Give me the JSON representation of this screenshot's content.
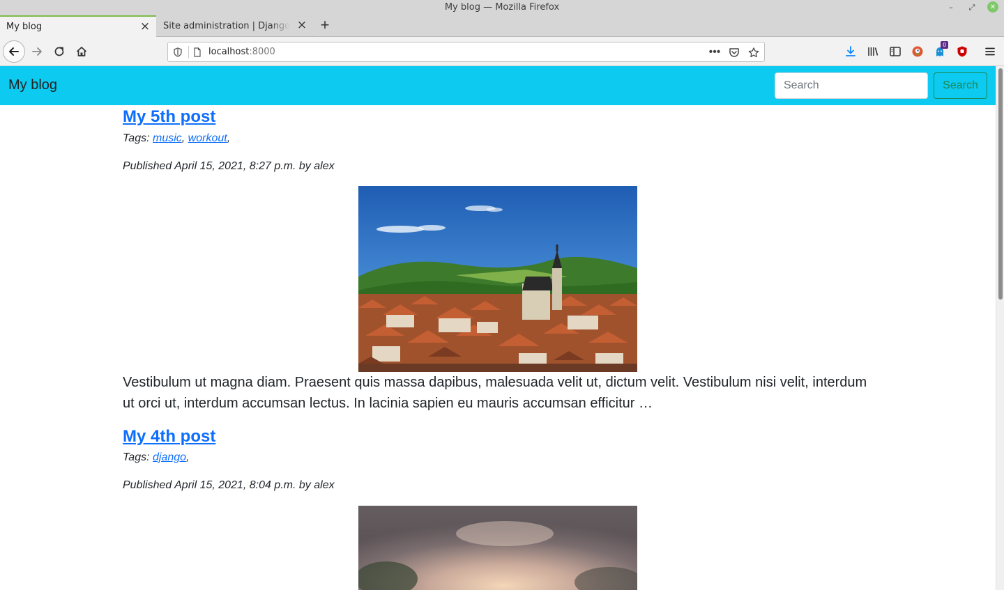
{
  "window": {
    "title": "My blog — Mozilla Firefox"
  },
  "tabs": [
    {
      "label": "My blog",
      "active": true
    },
    {
      "label": "Site administration | Django site admin",
      "active": false
    }
  ],
  "urlbar": {
    "host": "localhost",
    "port": ":8000"
  },
  "toolbar": {
    "notification_badge": "0"
  },
  "site": {
    "brand": "My blog",
    "search_placeholder": "Search",
    "search_button": "Search",
    "accent_color": "#0dcaf0"
  },
  "posts": [
    {
      "title": "My 5th post",
      "tags_prefix": "Tags:",
      "tags": [
        "music",
        "workout"
      ],
      "published": "Published April 15, 2021, 8:27 p.m. by alex",
      "image": "town-with-church-photo",
      "excerpt": "Vestibulum ut magna diam. Praesent quis massa dapibus, malesuada velit ut, dictum velit. Vestibulum nisi velit, interdum ut orci ut, interdum accumsan lectus. In lacinia sapien eu mauris accumsan efficitur …"
    },
    {
      "title": "My 4th post",
      "tags_prefix": "Tags:",
      "tags": [
        "django"
      ],
      "published": "Published April 15, 2021, 8:04 p.m. by alex",
      "image": "blurred-sky-photo"
    }
  ]
}
